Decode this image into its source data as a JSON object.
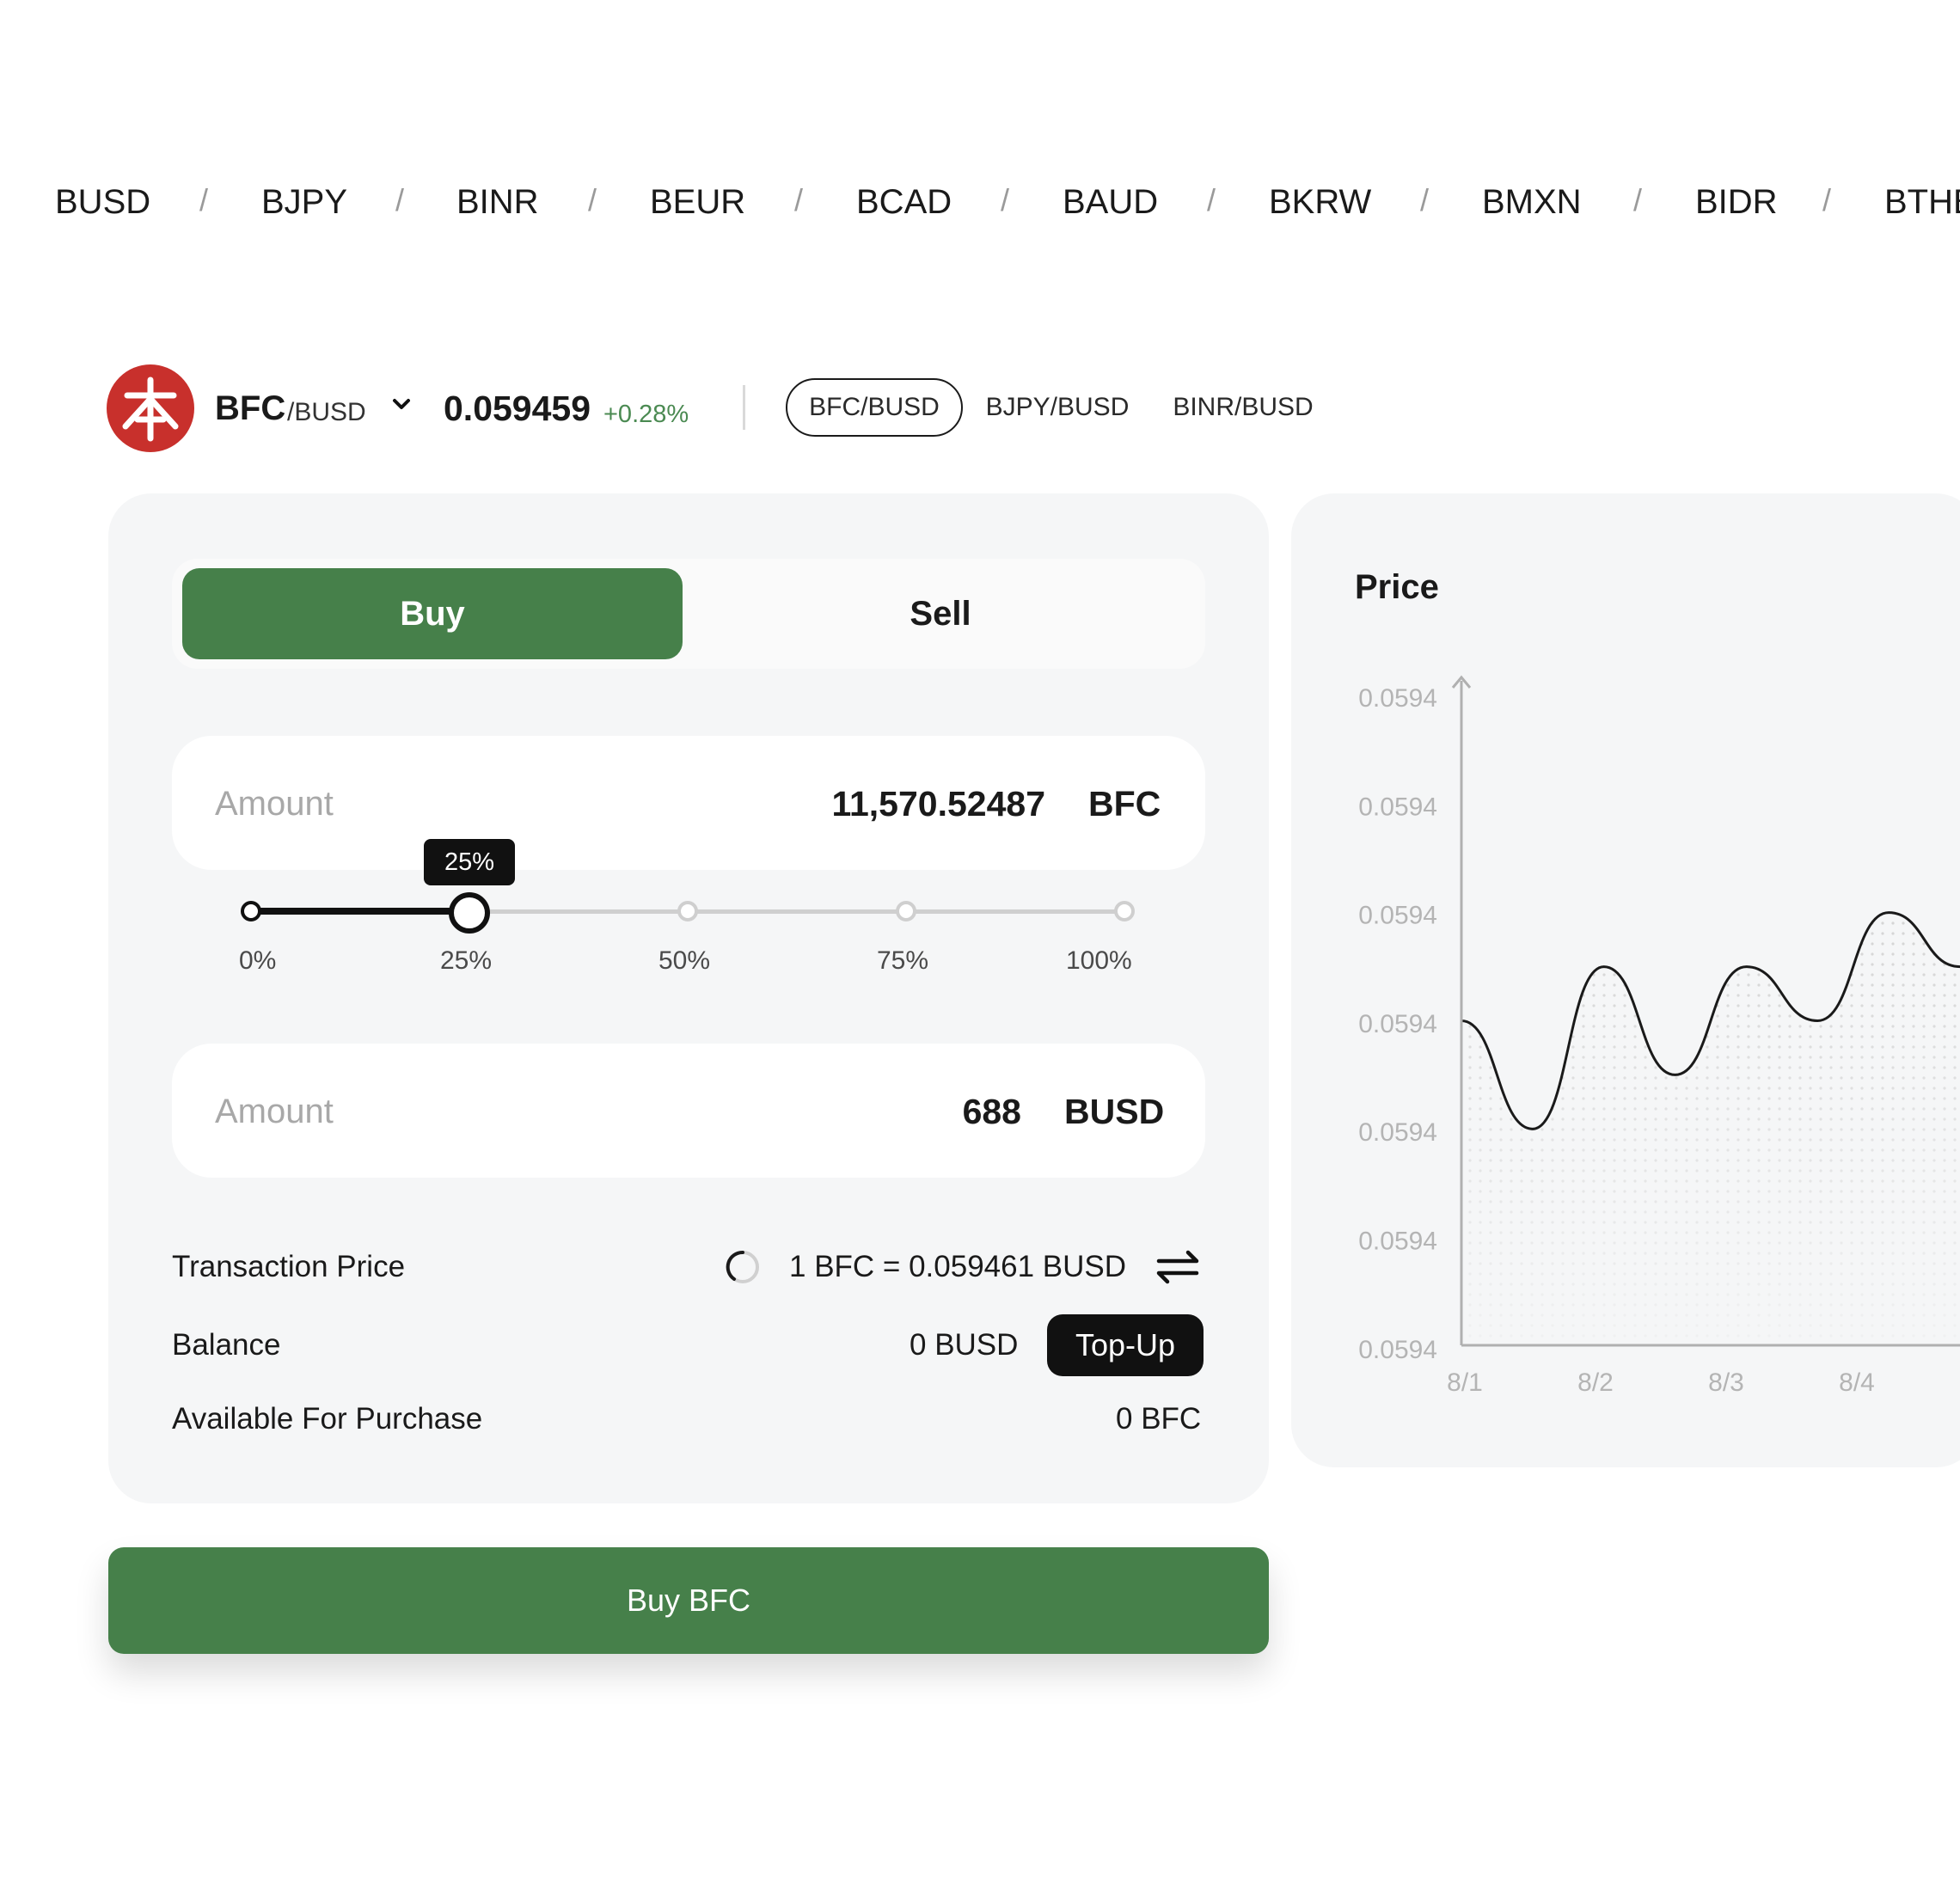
{
  "ticker": {
    "items": [
      "BUSD",
      "BJPY",
      "BINR",
      "BEUR",
      "BCAD",
      "BAUD",
      "BKRW",
      "BMXN",
      "BIDR",
      "BTHB"
    ],
    "separator": "/"
  },
  "pair": {
    "base": "BFC",
    "quote": "/BUSD",
    "price": "0.059459",
    "change": "+0.28%",
    "tabs": [
      "BFC/BUSD",
      "BJPY/BUSD",
      "BINR/BUSD"
    ],
    "active_tab": 0,
    "logo_icon": "bfc-logo-icon",
    "logo_color": "#c8302c"
  },
  "trade": {
    "buy_label": "Buy",
    "sell_label": "Sell",
    "amount_bfc": {
      "label": "Amount",
      "value": "11,570.52487",
      "unit": "BFC"
    },
    "amount_busd": {
      "label": "Amount",
      "value": "688",
      "unit": "BUSD"
    },
    "slider": {
      "value_fraction": 0.25,
      "tooltip": "25%",
      "ticks": [
        "0%",
        "25%",
        "50%",
        "75%",
        "100%"
      ]
    },
    "transaction_price": {
      "label": "Transaction Price",
      "value": "1 BFC = 0.059461 BUSD"
    },
    "balance": {
      "label": "Balance",
      "value": "0 BUSD",
      "topup_label": "Top-Up"
    },
    "available": {
      "label": "Available For Purchase",
      "value": "0 BFC"
    },
    "submit_label": "Buy BFC",
    "accent_color": "#46804a"
  },
  "chart_data": {
    "type": "area",
    "title": "Price",
    "y_tick_labels": [
      "0.0594",
      "0.0594",
      "0.0594",
      "0.0594",
      "0.0594",
      "0.0594",
      "0.0594"
    ],
    "x": [
      "8/1",
      "8/2",
      "8/3",
      "8/4"
    ],
    "series_values": [
      0.05946,
      0.05944,
      0.05947,
      0.05945,
      0.05947,
      0.05946,
      0.05948,
      0.05947
    ],
    "ylim": [
      0.0594,
      0.05952
    ],
    "grid": false
  }
}
